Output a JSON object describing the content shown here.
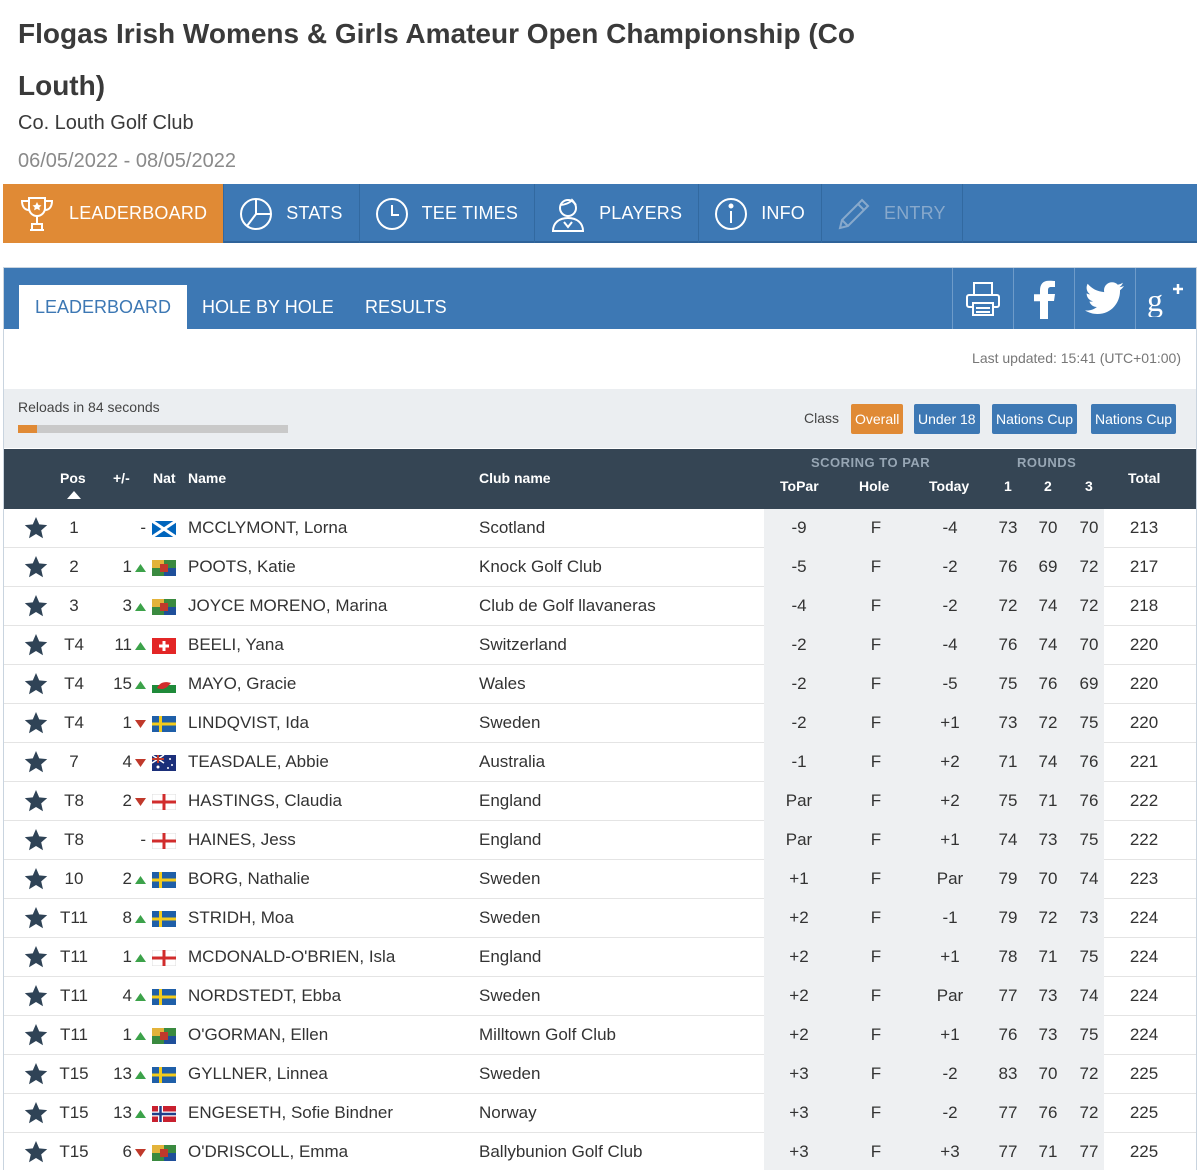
{
  "header": {
    "title": "Flogas Irish Womens & Girls Amateur Open Championship (Co Louth)",
    "club": "Co. Louth Golf Club",
    "dates": "06/05/2022 - 08/05/2022"
  },
  "main_nav": [
    {
      "label": "LEADERBOARD",
      "icon": "trophy-icon",
      "active": true
    },
    {
      "label": "STATS",
      "icon": "pie-chart-icon"
    },
    {
      "label": "TEE TIMES",
      "icon": "clock-icon"
    },
    {
      "label": "PLAYERS",
      "icon": "user-icon"
    },
    {
      "label": "INFO",
      "icon": "info-icon"
    },
    {
      "label": "ENTRY",
      "icon": "pencil-icon",
      "disabled": true
    }
  ],
  "sub_nav": [
    {
      "label": "LEADERBOARD",
      "active": true
    },
    {
      "label": "HOLE BY HOLE"
    },
    {
      "label": "RESULTS"
    }
  ],
  "share_icons": [
    "print-icon",
    "facebook-icon",
    "twitter-icon",
    "google-plus-icon"
  ],
  "last_updated": "Last updated: 15:41 (UTC+01:00)",
  "reload": {
    "text": "Reloads in 84 seconds",
    "progress": 0.07
  },
  "class_filter": {
    "label": "Class",
    "options": [
      {
        "label": "Overall",
        "active": true
      },
      {
        "label": "Under 18"
      },
      {
        "label": "Nations Cup"
      },
      {
        "label": "Nations Cup"
      }
    ]
  },
  "table": {
    "headers": {
      "pos": "Pos",
      "move": "+/-",
      "nat": "Nat",
      "name": "Name",
      "club": "Club name",
      "scoring_group": "SCORING TO PAR",
      "topar": "ToPar",
      "hole": "Hole",
      "today": "Today",
      "rounds_group": "ROUNDS",
      "r1": "1",
      "r2": "2",
      "r3": "3",
      "total": "Total"
    },
    "rows": [
      {
        "pos": "1",
        "move": "-",
        "dir": "",
        "flag": "scotland",
        "name": "MCCLYMONT, Lorna",
        "club": "Scotland",
        "topar": "-9",
        "hole": "F",
        "today": "-4",
        "r1": "73",
        "r2": "70",
        "r3": "70",
        "total": "213"
      },
      {
        "pos": "2",
        "move": "1",
        "dir": "up",
        "flag": "ireland",
        "name": "POOTS, Katie",
        "club": "Knock Golf Club",
        "topar": "-5",
        "hole": "F",
        "today": "-2",
        "r1": "76",
        "r2": "69",
        "r3": "72",
        "total": "217"
      },
      {
        "pos": "3",
        "move": "3",
        "dir": "up",
        "flag": "ireland",
        "name": "JOYCE MORENO, Marina",
        "club": "Club de Golf llavaneras",
        "topar": "-4",
        "hole": "F",
        "today": "-2",
        "r1": "72",
        "r2": "74",
        "r3": "72",
        "total": "218"
      },
      {
        "pos": "T4",
        "move": "11",
        "dir": "up",
        "flag": "switzerland",
        "name": "BEELI, Yana",
        "club": "Switzerland",
        "topar": "-2",
        "hole": "F",
        "today": "-4",
        "r1": "76",
        "r2": "74",
        "r3": "70",
        "total": "220"
      },
      {
        "pos": "T4",
        "move": "15",
        "dir": "up",
        "flag": "wales",
        "name": "MAYO, Gracie",
        "club": "Wales",
        "topar": "-2",
        "hole": "F",
        "today": "-5",
        "r1": "75",
        "r2": "76",
        "r3": "69",
        "total": "220"
      },
      {
        "pos": "T4",
        "move": "1",
        "dir": "down",
        "flag": "sweden",
        "name": "LINDQVIST, Ida",
        "club": "Sweden",
        "topar": "-2",
        "hole": "F",
        "today": "+1",
        "r1": "73",
        "r2": "72",
        "r3": "75",
        "total": "220"
      },
      {
        "pos": "7",
        "move": "4",
        "dir": "down",
        "flag": "australia",
        "name": "TEASDALE, Abbie",
        "club": "Australia",
        "topar": "-1",
        "hole": "F",
        "today": "+2",
        "r1": "71",
        "r2": "74",
        "r3": "76",
        "total": "221"
      },
      {
        "pos": "T8",
        "move": "2",
        "dir": "down",
        "flag": "england",
        "name": "HASTINGS, Claudia",
        "club": "England",
        "topar": "Par",
        "hole": "F",
        "today": "+2",
        "r1": "75",
        "r2": "71",
        "r3": "76",
        "total": "222"
      },
      {
        "pos": "T8",
        "move": "-",
        "dir": "",
        "flag": "england",
        "name": "HAINES, Jess",
        "club": "England",
        "topar": "Par",
        "hole": "F",
        "today": "+1",
        "r1": "74",
        "r2": "73",
        "r3": "75",
        "total": "222"
      },
      {
        "pos": "10",
        "move": "2",
        "dir": "up",
        "flag": "sweden",
        "name": "BORG, Nathalie",
        "club": "Sweden",
        "topar": "+1",
        "hole": "F",
        "today": "Par",
        "r1": "79",
        "r2": "70",
        "r3": "74",
        "total": "223"
      },
      {
        "pos": "T11",
        "move": "8",
        "dir": "up",
        "flag": "sweden",
        "name": "STRIDH, Moa",
        "club": "Sweden",
        "topar": "+2",
        "hole": "F",
        "today": "-1",
        "r1": "79",
        "r2": "72",
        "r3": "73",
        "total": "224"
      },
      {
        "pos": "T11",
        "move": "1",
        "dir": "up",
        "flag": "england",
        "name": "MCDONALD-O'BRIEN, Isla",
        "club": "England",
        "topar": "+2",
        "hole": "F",
        "today": "+1",
        "r1": "78",
        "r2": "71",
        "r3": "75",
        "total": "224"
      },
      {
        "pos": "T11",
        "move": "4",
        "dir": "up",
        "flag": "sweden",
        "name": "NORDSTEDT, Ebba",
        "club": "Sweden",
        "topar": "+2",
        "hole": "F",
        "today": "Par",
        "r1": "77",
        "r2": "73",
        "r3": "74",
        "total": "224"
      },
      {
        "pos": "T11",
        "move": "1",
        "dir": "up",
        "flag": "ireland",
        "name": "O'GORMAN, Ellen",
        "club": "Milltown Golf Club",
        "topar": "+2",
        "hole": "F",
        "today": "+1",
        "r1": "76",
        "r2": "73",
        "r3": "75",
        "total": "224"
      },
      {
        "pos": "T15",
        "move": "13",
        "dir": "up",
        "flag": "sweden",
        "name": "GYLLNER, Linnea",
        "club": "Sweden",
        "topar": "+3",
        "hole": "F",
        "today": "-2",
        "r1": "83",
        "r2": "70",
        "r3": "72",
        "total": "225"
      },
      {
        "pos": "T15",
        "move": "13",
        "dir": "up",
        "flag": "norway",
        "name": "ENGESETH, Sofie Bindner",
        "club": "Norway",
        "topar": "+3",
        "hole": "F",
        "today": "-2",
        "r1": "77",
        "r2": "76",
        "r3": "72",
        "total": "225"
      },
      {
        "pos": "T15",
        "move": "6",
        "dir": "down",
        "flag": "ireland",
        "name": "O'DRISCOLL, Emma",
        "club": "Ballybunion Golf Club",
        "topar": "+3",
        "hole": "F",
        "today": "+3",
        "r1": "77",
        "r2": "71",
        "r3": "77",
        "total": "225"
      }
    ]
  },
  "colors": {
    "nav_blue": "#3d78b4",
    "accent_orange": "#e08a35",
    "header_dark": "#354554",
    "up_green": "#3ca24a",
    "down_red": "#c0392b"
  }
}
